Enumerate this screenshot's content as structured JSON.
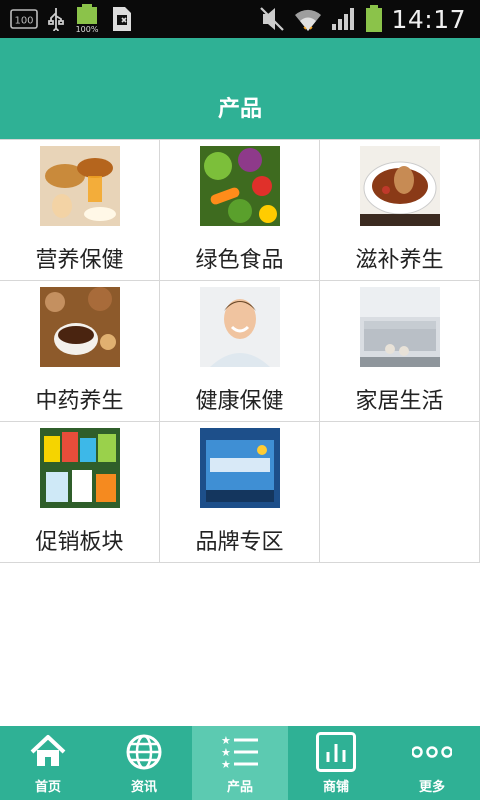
{
  "status_bar": {
    "time": "14:17",
    "sd_label": "100",
    "battery_small_label": "100%"
  },
  "header": {
    "title": "产品"
  },
  "products": [
    {
      "label": "营养保健",
      "icon": "food-photo"
    },
    {
      "label": "绿色食品",
      "icon": "vegetables-photo"
    },
    {
      "label": "滋补养生",
      "icon": "soup-photo"
    },
    {
      "label": "中药养生",
      "icon": "herbal-tea-photo"
    },
    {
      "label": "健康保健",
      "icon": "smiling-man-photo"
    },
    {
      "label": "家居生活",
      "icon": "kitchen-photo"
    },
    {
      "label": "促销板块",
      "icon": "promotion-goods-photo"
    },
    {
      "label": "品牌专区",
      "icon": "brand-box-photo"
    }
  ],
  "tabs": [
    {
      "label": "首页",
      "icon": "home-icon"
    },
    {
      "label": "资讯",
      "icon": "globe-icon"
    },
    {
      "label": "产品",
      "icon": "list-star-icon",
      "active": true
    },
    {
      "label": "商铺",
      "icon": "bar-chart-icon"
    },
    {
      "label": "更多",
      "icon": "more-dots-icon"
    }
  ],
  "colors": {
    "accent": "#2fb195",
    "tab_active": "#5ccab1",
    "status_bar": "#0a0a0a"
  }
}
